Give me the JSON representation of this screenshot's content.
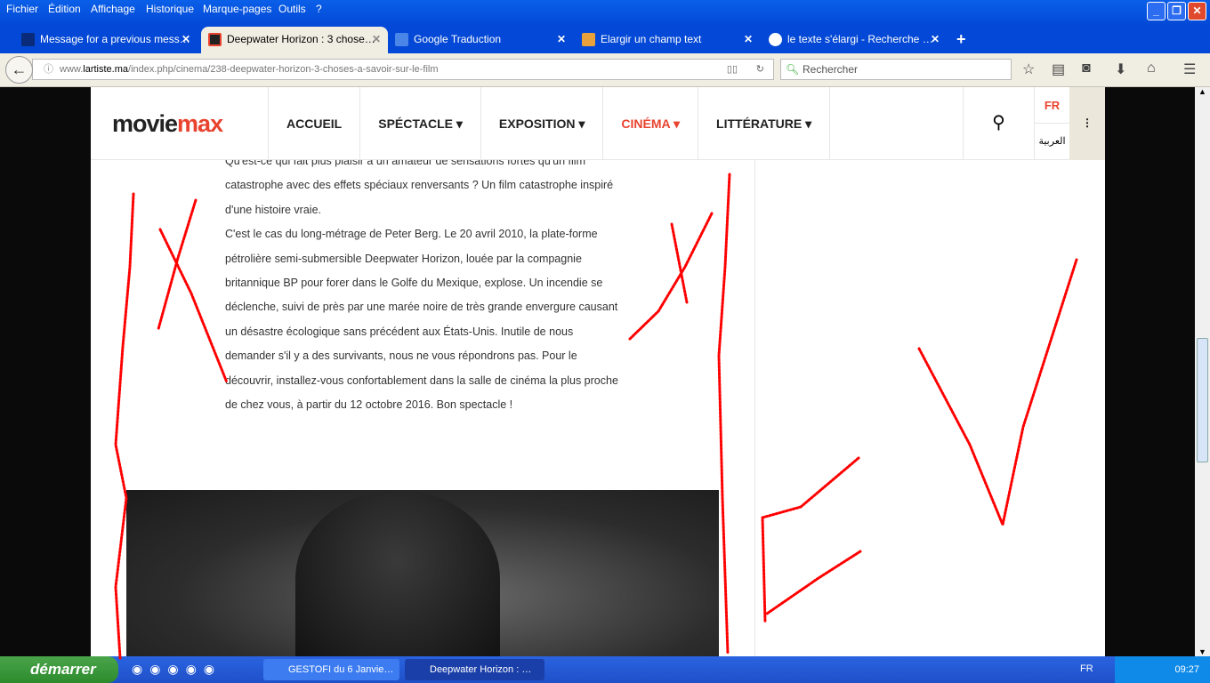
{
  "menu": [
    "Fichier",
    "Édition",
    "Affichage",
    "Historique",
    "Marque-pages",
    "Outils",
    "?"
  ],
  "tabs": [
    {
      "label": "Message for a previous mess…",
      "icon": "triangle-icon"
    },
    {
      "label": "Deepwater Horizon : 3 chose…",
      "icon": "joomla-icon",
      "active": true
    },
    {
      "label": "Google Traduction",
      "icon": "google-translate-icon"
    },
    {
      "label": "Elargir un champ text",
      "icon": "site-icon"
    },
    {
      "label": "le texte s'élargi - Recherche …",
      "icon": "google-icon"
    }
  ],
  "url": {
    "prefix": "www.",
    "domain": "lartiste.ma",
    "path": "/index.php/cinema/238-deepwater-horizon-3-choses-a-savoir-sur-le-film"
  },
  "search_placeholder": "Rechercher",
  "site": {
    "logo_a": "movie",
    "logo_b": "max",
    "nav": [
      "ACCUEIL",
      "SPÉCTACLE ▾",
      "EXPOSITION ▾",
      "CINÉMA ▾",
      "LITTÉRATURE ▾"
    ],
    "lang_fr": "FR",
    "lang_ar": "العربية"
  },
  "article": {
    "p1": "Qu'est-ce qui fait plus plaisir à un amateur de sensations fortes qu'un film catastrophe avec des effets spéciaux renversants ? Un film catastrophe inspiré d'une histoire vraie.",
    "p2": "C'est le cas du long-métrage de Peter Berg. Le 20 avril 2010, la plate-forme pétrolière semi-submersible Deepwater Horizon, louée par la compagnie britannique BP pour forer dans le Golfe du Mexique, explose. Un incendie se déclenche, suivi de près par une marée noire de très grande envergure causant un désastre écologique sans précédent aux États-Unis. Inutile de nous demander s'il y a des survivants, nous ne vous répondrons pas. Pour le découvrir, installez-vous confortablement dans la salle de cinéma la plus proche de chez vous, à partir du 12 octobre 2016. Bon spectacle !"
  },
  "taskbar": {
    "start": "démarrer",
    "tasks": [
      "GESTOFI du 6 Janvie…",
      "Deepwater Horizon : …"
    ],
    "lang": "FR",
    "time": "09:27"
  },
  "colors": {
    "accent": "#e8432e",
    "scribble": "#ff0000"
  }
}
